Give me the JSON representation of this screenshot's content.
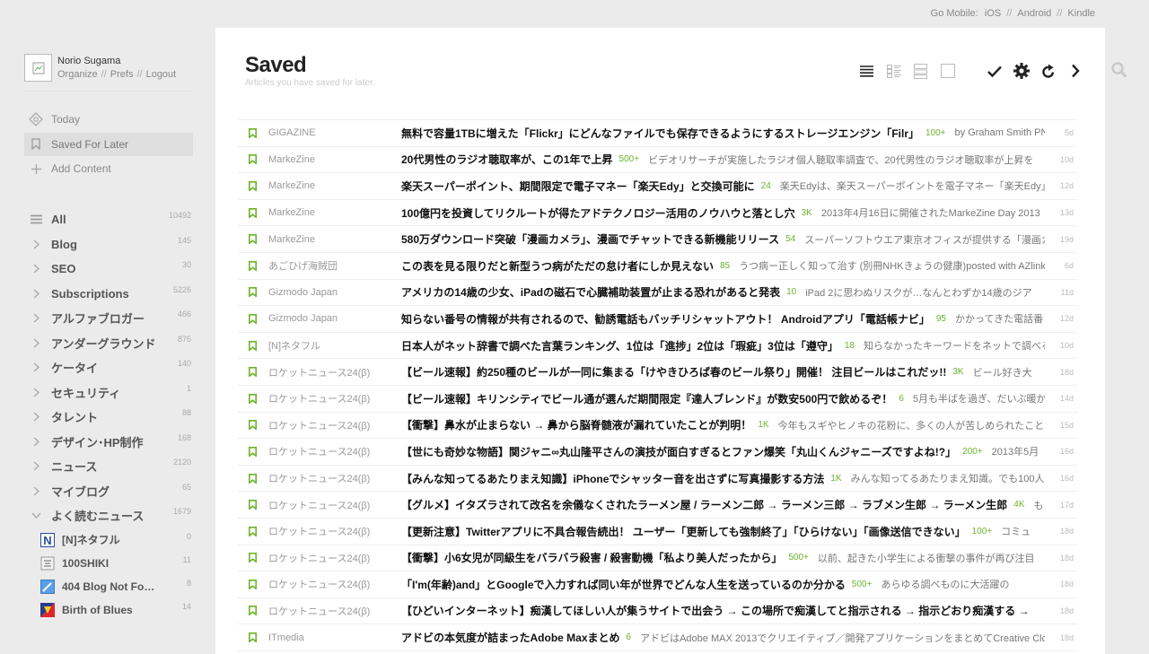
{
  "top": {
    "prefix": "Go Mobile:",
    "links": [
      "iOS",
      "Android",
      "Kindle"
    ],
    "sep": "//"
  },
  "profile": {
    "name": "Norio Sugama",
    "links": [
      "Organize",
      "Prefs",
      "Logout"
    ]
  },
  "nav": [
    {
      "label": "Today",
      "icon": "today-icon",
      "active": false
    },
    {
      "label": "Saved For Later",
      "icon": "bookmark-icon",
      "active": true
    },
    {
      "label": "Add Content",
      "icon": "plus-icon",
      "active": false
    }
  ],
  "feeds": [
    {
      "label": "All",
      "count": "10492",
      "icon": "list-icon"
    },
    {
      "label": "Blog",
      "count": "145",
      "icon": "chevron-right-icon"
    },
    {
      "label": "SEO",
      "count": "30",
      "icon": "chevron-right-icon"
    },
    {
      "label": "Subscriptions",
      "count": "5226",
      "icon": "chevron-right-icon"
    },
    {
      "label": "アルファブロガー",
      "count": "466",
      "icon": "chevron-right-icon"
    },
    {
      "label": "アンダーグラウンド",
      "count": "875",
      "icon": "chevron-right-icon"
    },
    {
      "label": "ケータイ",
      "count": "140",
      "icon": "chevron-right-icon"
    },
    {
      "label": "セキュリティ",
      "count": "1",
      "icon": "chevron-right-icon"
    },
    {
      "label": "タレント",
      "count": "88",
      "icon": "chevron-right-icon"
    },
    {
      "label": "デザイン･HP制作",
      "count": "168",
      "icon": "chevron-right-icon"
    },
    {
      "label": "ニュース",
      "count": "2120",
      "icon": "chevron-right-icon"
    },
    {
      "label": "マイブログ",
      "count": "65",
      "icon": "chevron-right-icon"
    },
    {
      "label": "よく読むニュース",
      "count": "1679",
      "icon": "chevron-down-icon"
    }
  ],
  "subfeeds": [
    {
      "label": "[N]ネタフル",
      "count": "0",
      "icon": "netaful-favicon"
    },
    {
      "label": "100SHIKI",
      "count": "11",
      "icon": "100shiki-favicon"
    },
    {
      "label": "404 Blog Not Fo…",
      "count": "8",
      "icon": "404blog-favicon"
    },
    {
      "label": "Birth of Blues",
      "count": "14",
      "icon": "birthofblues-favicon"
    }
  ],
  "main": {
    "title": "Saved",
    "subtitle": "Articles you have saved for later."
  },
  "toolbar": [
    "titles-view-icon",
    "magazine-view-icon",
    "cards-view-icon",
    "full-article-view-icon",
    "mark-read-icon",
    "settings-gear-icon",
    "refresh-icon",
    "next-arrow-icon"
  ],
  "colors": {
    "accent": "#6db32c",
    "bg": "#ebebeb",
    "panel": "#ffffff"
  },
  "articles": [
    {
      "source": "GIGAZINE",
      "title": "無料で容量1TBに増えた「Flickr」にどんなファイルでも保存できるようにするストレージエンジン「Filr」",
      "pop": "100+",
      "snippet": "by Graham Smith PNG",
      "age": "5d"
    },
    {
      "source": "MarkeZine",
      "title": "20代男性のラジオ聴取率が、この1年で上昇",
      "pop": "500+",
      "snippet": "ビデオリサーチが実施したラジオ個人聴取率調査で、20代男性のラジオ聴取率が上昇を",
      "age": "10d"
    },
    {
      "source": "MarkeZine",
      "title": "楽天スーパーポイント、期間限定で電子マネー「楽天Edy」と交換可能に",
      "pop": "24",
      "snippet": "楽天Edyは、楽天スーパーポイントを電子マネー「楽天Edy」",
      "age": "12d"
    },
    {
      "source": "MarkeZine",
      "title": "100億円を投資してリクルートが得たアドテクノロジー活用のノウハウと落とし穴",
      "pop": "3K",
      "snippet": "2013年4月16日に開催されたMarkeZine Day 2013",
      "age": "13d"
    },
    {
      "source": "MarkeZine",
      "title": "580万ダウンロード突破「漫画カメラ」、漫画でチャットできる新機能リリース",
      "pop": "54",
      "snippet": "スーパーソフトウエア東京オフィスが提供する「漫画カメ",
      "age": "19d"
    },
    {
      "source": "あごひげ海賊団",
      "title": "この表を見る限りだと新型うつ病がただの怠け者にしか見えない",
      "pop": "85",
      "snippet": "うつ病ー正しく知って治す (別冊NHKきょうの健康)posted with AZlink",
      "age": "6d"
    },
    {
      "source": "Gizmodo Japan",
      "title": "アメリカの14歳の少女、iPadの磁石で心臓補助装置が止まる恐れがあると発表",
      "pop": "10",
      "snippet": "iPad 2に思わぬリスクが…なんとわずか14歳のジア",
      "age": "11d"
    },
    {
      "source": "Gizmodo Japan",
      "title": "知らない番号の情報が共有されるので、勧誘電話もバッチリシャットアウト！ Androidアプリ「電話帳ナビ」",
      "pop": "95",
      "snippet": "かかってきた電話番",
      "age": "12d"
    },
    {
      "source": "[N]ネタフル",
      "title": "日本人がネット辞書で調べた言葉ランキング、1位は「進捗」2位は「瑕疵」3位は「遵守」",
      "pop": "18",
      "snippet": "知らなかったキーワードをネットで調べるこ",
      "age": "10d"
    },
    {
      "source": "ロケットニュース24(β)",
      "title": "【ビール速報】約250種のビールが一同に集まる「けやきひろば春のビール祭り」開催！ 注目ビールはこれだッ!!",
      "pop": "3K",
      "snippet": "ビール好き大",
      "age": "18d"
    },
    {
      "source": "ロケットニュース24(β)",
      "title": "【ビール速報】キリンシティでビール通が選んだ期間限定『達人ブレンド』が数安500円で飲めるぞ！",
      "pop": "6",
      "snippet": "5月も半ばを過ぎ、だいぶ暖か",
      "age": "14d"
    },
    {
      "source": "ロケットニュース24(β)",
      "title": "【衝撃】鼻水が止まらない → 鼻から脳脊髄液が漏れていたことが判明！",
      "pop": "1K",
      "snippet": "今年もスギやヒノキの花粉に、多くの人が苦しめられたこと",
      "age": "15d"
    },
    {
      "source": "ロケットニュース24(β)",
      "title": "【世にも奇妙な物語】関ジャニ∞丸山隆平さんの演技が面白すぎるとファン爆笑「丸山くんジャニーズですよね!?」",
      "pop": "200+",
      "snippet": "2013年5月",
      "age": "16d"
    },
    {
      "source": "ロケットニュース24(β)",
      "title": "【みんな知ってるあたりまえ知識】iPhoneでシャッター音を出さずに写真撮影する方法",
      "pop": "1K",
      "snippet": "みんな知ってるあたりまえ知識。でも100人い",
      "age": "16d"
    },
    {
      "source": "ロケットニュース24(β)",
      "title": "【グルメ】イタズラされて改名を余儀なくされたラーメン屋 / ラーメン二郎 → ラーメン三郎 → ラブメン生郎 → ラーメン生郎",
      "pop": "4K",
      "snippet": "も",
      "age": "17d"
    },
    {
      "source": "ロケットニュース24(β)",
      "title": "【更新注意】Twitterアプリに不具合報告続出！ ユーザー「更新しても強制終了」「ひらけない」「画像送信できない」",
      "pop": "100+",
      "snippet": "コミュ",
      "age": "18d"
    },
    {
      "source": "ロケットニュース24(β)",
      "title": "【衝撃】小6女児が同級生をバラバラ殺害 / 殺害動機「私より美人だったから」",
      "pop": "500+",
      "snippet": "以前、起きた小学生による衝撃の事件が再び注目",
      "age": "18d"
    },
    {
      "source": "ロケットニュース24(β)",
      "title": "「I'm(年齢)and」とGoogleで入力すれば同い年が世界でどんな人生を送っているのか分かる",
      "pop": "500+",
      "snippet": "あらゆる調べものに大活躍の",
      "age": "18d"
    },
    {
      "source": "ロケットニュース24(β)",
      "title": "【ひどいインターネット】痴漢してほしい人が集うサイトで出会う → この場所で痴漢してと指示される → 指示どおり痴漢する →",
      "pop": "",
      "snippet": "",
      "age": "18d"
    },
    {
      "source": "ITmedia",
      "title": "アドビの本気度が詰まったAdobe Maxまとめ",
      "pop": "6",
      "snippet": "アドビはAdobe MAX 2013でクリエイティブ／開発アプリケーションをまとめてCreative Cloudの",
      "age": "18d"
    }
  ]
}
